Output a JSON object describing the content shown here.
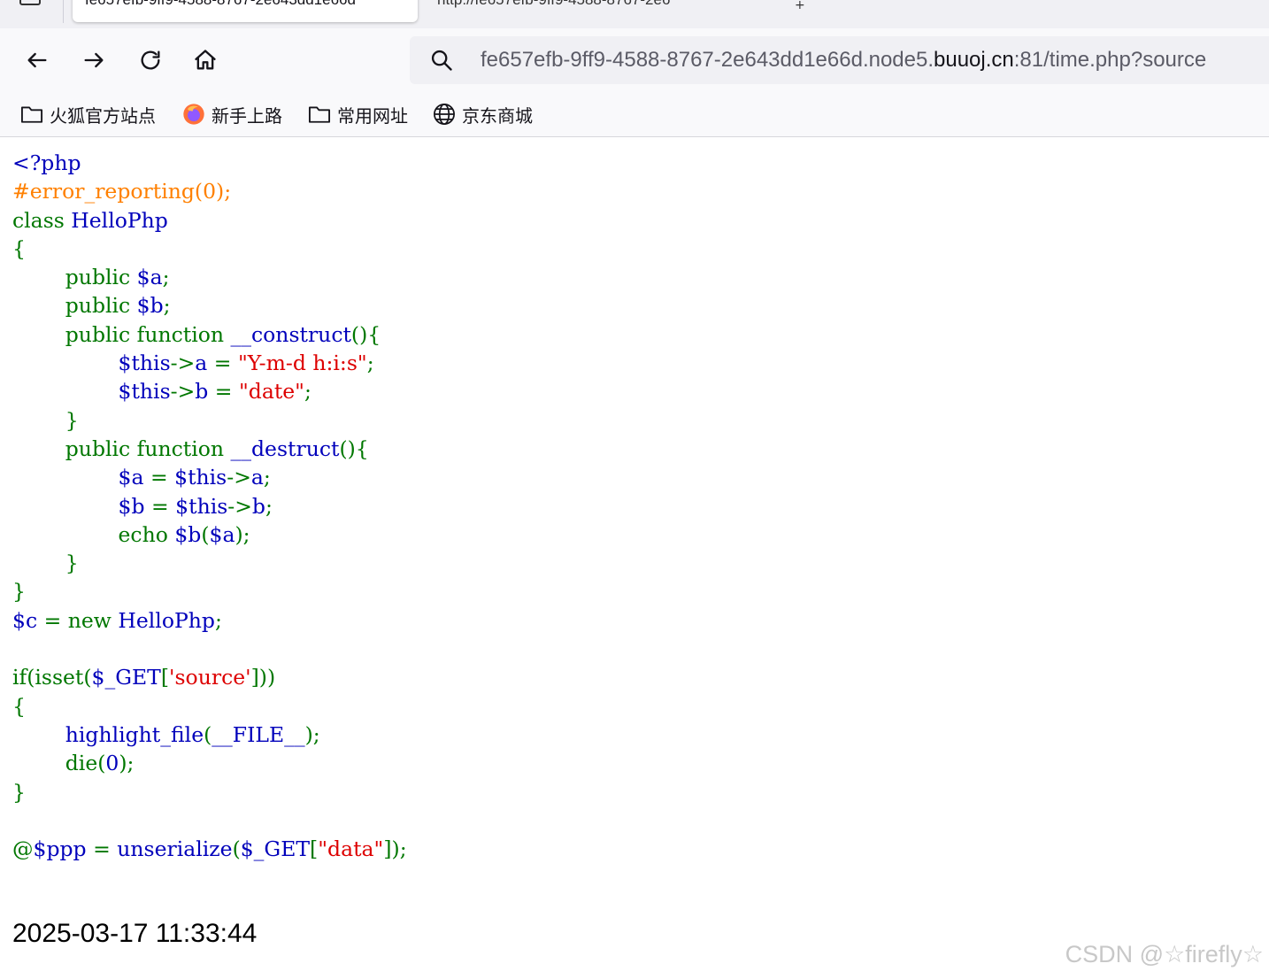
{
  "tabs": [
    {
      "label": "fe657efb-9ff9-4588-8767-2e643dd1e66d"
    },
    {
      "label": "http://fe657efb-9ff9-4588-8767-2e6"
    }
  ],
  "toolbar": {
    "back_icon": "arrow-left-icon",
    "forward_icon": "arrow-right-icon",
    "reload_icon": "reload-icon",
    "home_icon": "home-icon"
  },
  "urlbar": {
    "prefix": "fe657efb-9ff9-4588-8767-2e643dd1e66d.node5.",
    "host": "buuoj.cn",
    "suffix": ":81/time.php?source"
  },
  "bookmarks": [
    {
      "label": "火狐官方站点",
      "icon": "folder-icon"
    },
    {
      "label": "新手上路",
      "icon": "firefox-icon"
    },
    {
      "label": "常用网址",
      "icon": "folder-icon"
    },
    {
      "label": "京东商城",
      "icon": "globe-icon"
    }
  ],
  "code_lines": [
    [
      {
        "t": "<?php",
        "c": "blue"
      }
    ],
    [
      {
        "t": "#error_reporting(0);",
        "c": "orange"
      }
    ],
    [
      {
        "t": "class ",
        "c": "green"
      },
      {
        "t": "HelloPhp",
        "c": "blue"
      }
    ],
    [
      {
        "t": "{",
        "c": "green"
      }
    ],
    [
      {
        "t": "        public ",
        "c": "green"
      },
      {
        "t": "$a",
        "c": "blue"
      },
      {
        "t": ";",
        "c": "green"
      }
    ],
    [
      {
        "t": "        public ",
        "c": "green"
      },
      {
        "t": "$b",
        "c": "blue"
      },
      {
        "t": ";",
        "c": "green"
      }
    ],
    [
      {
        "t": "        public function ",
        "c": "green"
      },
      {
        "t": "__construct",
        "c": "blue"
      },
      {
        "t": "(){",
        "c": "green"
      }
    ],
    [
      {
        "t": "                ",
        "c": "green"
      },
      {
        "t": "$this",
        "c": "blue"
      },
      {
        "t": "->",
        "c": "green"
      },
      {
        "t": "a ",
        "c": "blue"
      },
      {
        "t": "= ",
        "c": "green"
      },
      {
        "t": "\"Y-m-d h:i:s\"",
        "c": "red"
      },
      {
        "t": ";",
        "c": "green"
      }
    ],
    [
      {
        "t": "                ",
        "c": "green"
      },
      {
        "t": "$this",
        "c": "blue"
      },
      {
        "t": "->",
        "c": "green"
      },
      {
        "t": "b ",
        "c": "blue"
      },
      {
        "t": "= ",
        "c": "green"
      },
      {
        "t": "\"date\"",
        "c": "red"
      },
      {
        "t": ";",
        "c": "green"
      }
    ],
    [
      {
        "t": "        }",
        "c": "green"
      }
    ],
    [
      {
        "t": "        public function ",
        "c": "green"
      },
      {
        "t": "__destruct",
        "c": "blue"
      },
      {
        "t": "(){",
        "c": "green"
      }
    ],
    [
      {
        "t": "                ",
        "c": "green"
      },
      {
        "t": "$a ",
        "c": "blue"
      },
      {
        "t": "= ",
        "c": "green"
      },
      {
        "t": "$this",
        "c": "blue"
      },
      {
        "t": "->",
        "c": "green"
      },
      {
        "t": "a",
        "c": "blue"
      },
      {
        "t": ";",
        "c": "green"
      }
    ],
    [
      {
        "t": "                ",
        "c": "green"
      },
      {
        "t": "$b ",
        "c": "blue"
      },
      {
        "t": "= ",
        "c": "green"
      },
      {
        "t": "$this",
        "c": "blue"
      },
      {
        "t": "->",
        "c": "green"
      },
      {
        "t": "b",
        "c": "blue"
      },
      {
        "t": ";",
        "c": "green"
      }
    ],
    [
      {
        "t": "                echo ",
        "c": "green"
      },
      {
        "t": "$b",
        "c": "blue"
      },
      {
        "t": "(",
        "c": "green"
      },
      {
        "t": "$a",
        "c": "blue"
      },
      {
        "t": ");",
        "c": "green"
      }
    ],
    [
      {
        "t": "        }",
        "c": "green"
      }
    ],
    [
      {
        "t": "}",
        "c": "green"
      }
    ],
    [
      {
        "t": "$c ",
        "c": "blue"
      },
      {
        "t": "= new ",
        "c": "green"
      },
      {
        "t": "HelloPhp",
        "c": "blue"
      },
      {
        "t": ";",
        "c": "green"
      }
    ],
    [
      {
        "t": " ",
        "c": "blue"
      }
    ],
    [
      {
        "t": "if(isset(",
        "c": "green"
      },
      {
        "t": "$_GET",
        "c": "blue"
      },
      {
        "t": "[",
        "c": "green"
      },
      {
        "t": "'source'",
        "c": "red"
      },
      {
        "t": "]))",
        "c": "green"
      }
    ],
    [
      {
        "t": "{",
        "c": "green"
      }
    ],
    [
      {
        "t": "        ",
        "c": "green"
      },
      {
        "t": "highlight_file",
        "c": "blue"
      },
      {
        "t": "(",
        "c": "green"
      },
      {
        "t": "__FILE__",
        "c": "blue"
      },
      {
        "t": ");",
        "c": "green"
      }
    ],
    [
      {
        "t": "        ",
        "c": "green"
      },
      {
        "t": "die",
        "c": "green"
      },
      {
        "t": "(",
        "c": "green"
      },
      {
        "t": "0",
        "c": "blue"
      },
      {
        "t": ");",
        "c": "green"
      }
    ],
    [
      {
        "t": "}",
        "c": "green"
      }
    ],
    [
      {
        "t": " ",
        "c": "blue"
      }
    ],
    [
      {
        "t": "@",
        "c": "green"
      },
      {
        "t": "$ppp ",
        "c": "blue"
      },
      {
        "t": "= ",
        "c": "green"
      },
      {
        "t": "unserialize",
        "c": "blue"
      },
      {
        "t": "(",
        "c": "green"
      },
      {
        "t": "$_GET",
        "c": "blue"
      },
      {
        "t": "[",
        "c": "green"
      },
      {
        "t": "\"data\"",
        "c": "red"
      },
      {
        "t": "]);",
        "c": "green"
      }
    ]
  ],
  "colors": {
    "blue": "#0000bb",
    "green": "#007700",
    "red": "#dd0000",
    "orange": "#ff8000"
  },
  "output": {
    "timestamp": "2025-03-17 11:33:44"
  },
  "watermark": "CSDN @☆firefly☆"
}
